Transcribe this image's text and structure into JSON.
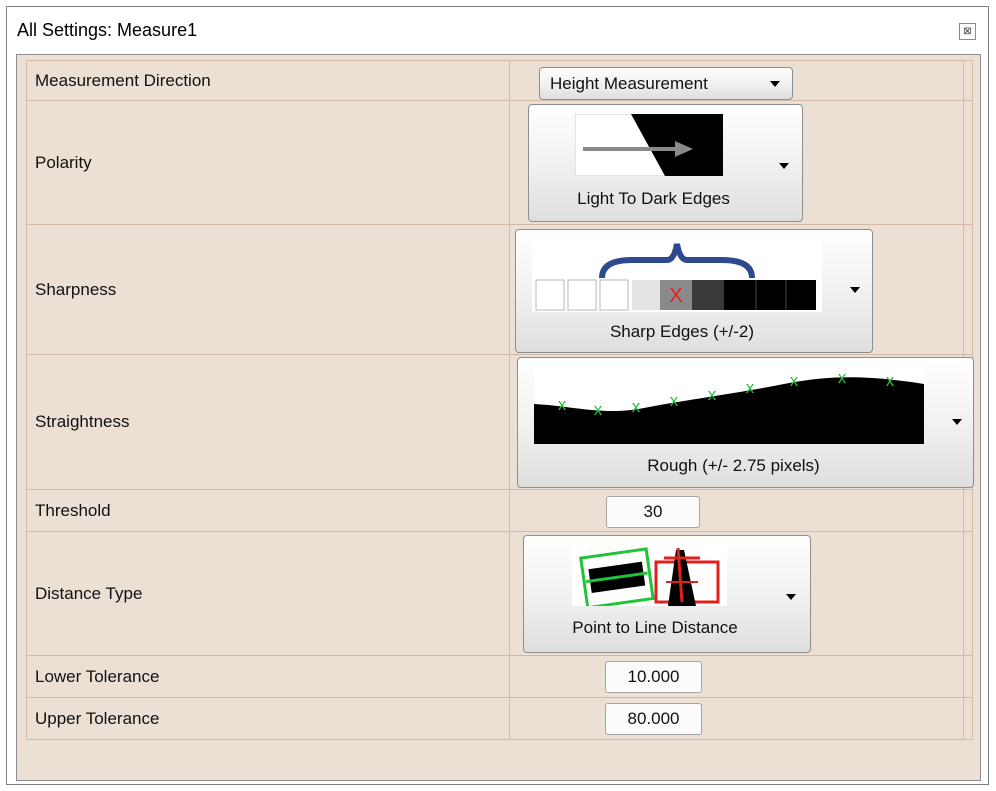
{
  "window": {
    "title": "All Settings: Measure1",
    "close_glyph": "⊠"
  },
  "rows": {
    "measurement_direction": {
      "label": "Measurement Direction",
      "value": "Height Measurement"
    },
    "polarity": {
      "label": "Polarity",
      "value": "Light To Dark Edges",
      "icon": "light-to-dark-edge-icon"
    },
    "sharpness": {
      "label": "Sharpness",
      "value": "Sharp Edges (+/-2)",
      "icon": "sharp-edges-icon",
      "marker": "X"
    },
    "straightness": {
      "label": "Straightness",
      "value": "Rough (+/- 2.75 pixels)",
      "icon": "rough-edge-icon",
      "marker": "x"
    },
    "threshold": {
      "label": "Threshold",
      "value": "30"
    },
    "distance_type": {
      "label": "Distance Type",
      "value": "Point to Line Distance",
      "icon": "point-to-line-distance-icon"
    },
    "lower_tolerance": {
      "label": "Lower Tolerance",
      "value": "10.000"
    },
    "upper_tolerance": {
      "label": "Upper Tolerance",
      "value": "80.000"
    }
  },
  "colors": {
    "panel_bg": "#ebe0d3",
    "grid_line": "#d3b9a6",
    "brace_blue": "#2e4a8e",
    "marker_red": "#e0201a",
    "marker_green": "#21c33a"
  }
}
